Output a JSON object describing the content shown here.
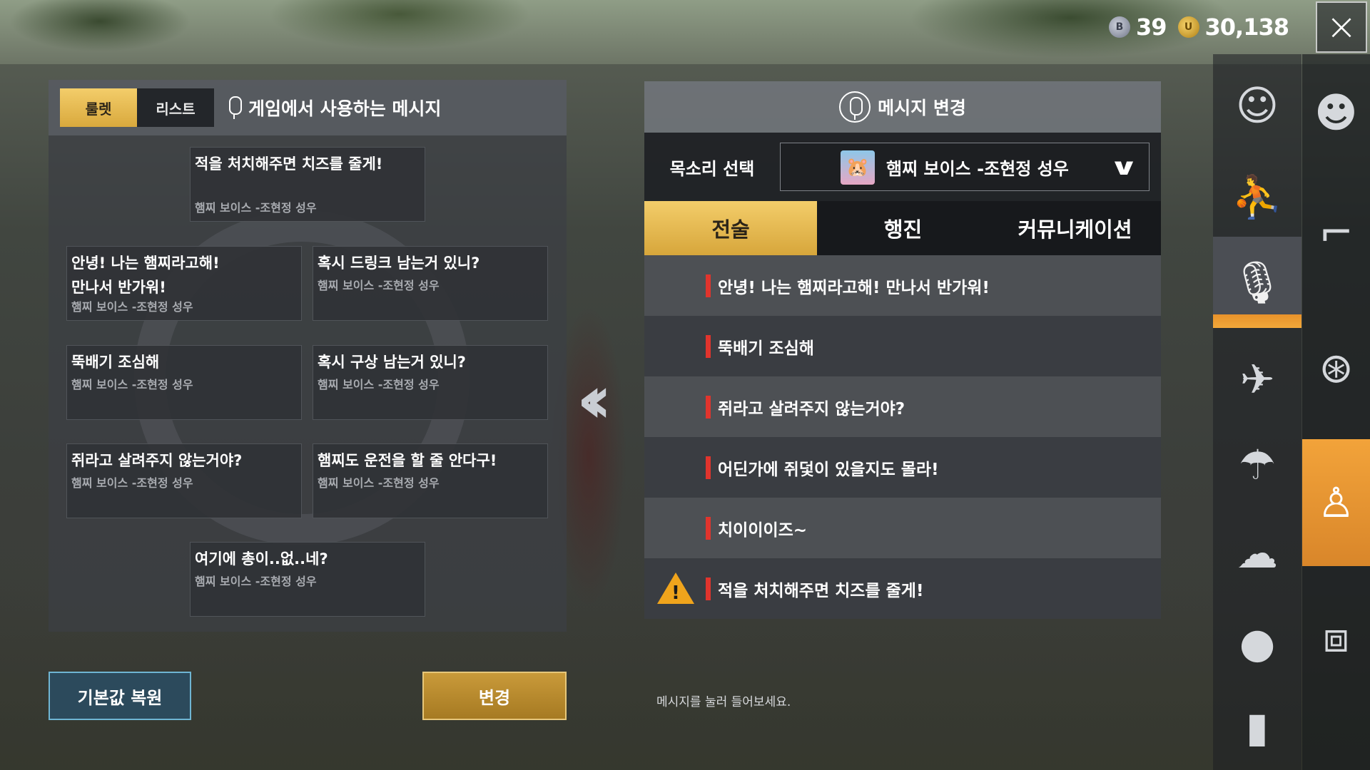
{
  "currency": {
    "bp_icon": "bp-coin-icon",
    "bp": "39",
    "uc_icon": "uc-coin-icon",
    "uc": "30,138"
  },
  "close_icon": "×",
  "left_panel": {
    "tabs": [
      {
        "label": "룰렛",
        "active": true
      },
      {
        "label": "리스트",
        "active": false
      }
    ],
    "title": "게임에서 사용하는 메시지",
    "cards": [
      {
        "text": "적을 처치해주면 치즈를 줄게!",
        "sub": "햄찌 보이스 -조현정 성우"
      },
      {
        "text": "안녕! 나는 햄찌라고해!\n만나서 반가워!",
        "sub": "햄찌 보이스 -조현정 성우"
      },
      {
        "text": "혹시 드링크 남는거 있니?",
        "sub": "햄찌 보이스 -조현정 성우"
      },
      {
        "text": "뚝배기 조심해",
        "sub": "햄찌 보이스 -조현정 성우"
      },
      {
        "text": "혹시 구상 남는거 있니?",
        "sub": "햄찌 보이스 -조현정 성우"
      },
      {
        "text": "쥐라고 살려주지 않는거야?",
        "sub": "햄찌 보이스 -조현정 성우"
      },
      {
        "text": "햄찌도 운전을 할 줄 안다구!",
        "sub": "햄찌 보이스 -조현정 성우"
      },
      {
        "text": "여기에 총이..없..네?",
        "sub": "햄찌 보이스 -조현정 성우"
      }
    ]
  },
  "buttons": {
    "reset": "기본값 복원",
    "change": "변경"
  },
  "swap_arrow": "«",
  "right_panel": {
    "title": "메시지 변경",
    "voice_label": "목소리 선택",
    "voice_value": "햄찌 보이스 -조현정 성우",
    "tabs": [
      {
        "label": "전술",
        "active": true
      },
      {
        "label": "행진",
        "active": false
      },
      {
        "label": "커뮤니케이션",
        "active": false
      }
    ],
    "items": [
      "안녕! 나는 햄찌라고해! 만나서 반가워!",
      "뚝배기 조심해",
      "쥐라고 살려주지 않는거야?",
      "어딘가에 쥐덫이 있을지도 몰라!",
      "치이이이즈~",
      "적을 처치해주면 치즈를 줄게!"
    ],
    "warning_index": 5,
    "hint": "메시지를 눌러 들어보세요."
  },
  "categories": {
    "col1": [
      {
        "icon": "emote-icon",
        "glyph": "☺"
      },
      {
        "icon": "run-icon",
        "glyph": "🏃"
      },
      {
        "icon": "microphone-icon",
        "glyph": "🎙",
        "active": true
      },
      {
        "icon": "airplane-icon",
        "glyph": "✈"
      },
      {
        "icon": "parachute-icon",
        "glyph": "☂"
      },
      {
        "icon": "smoke-icon",
        "glyph": "☁"
      },
      {
        "icon": "grenade-icon",
        "glyph": "●"
      },
      {
        "icon": "spray-icon",
        "glyph": "▮"
      }
    ],
    "col2": [
      {
        "icon": "character-icon",
        "glyph": "☻"
      },
      {
        "icon": "pistol-icon",
        "glyph": "🔫"
      },
      {
        "icon": "steering-wheel-icon",
        "glyph": "⊛"
      },
      {
        "icon": "companion-icon",
        "glyph": "⛑",
        "active": true
      },
      {
        "icon": "crate-icon",
        "glyph": "⧈"
      }
    ]
  }
}
